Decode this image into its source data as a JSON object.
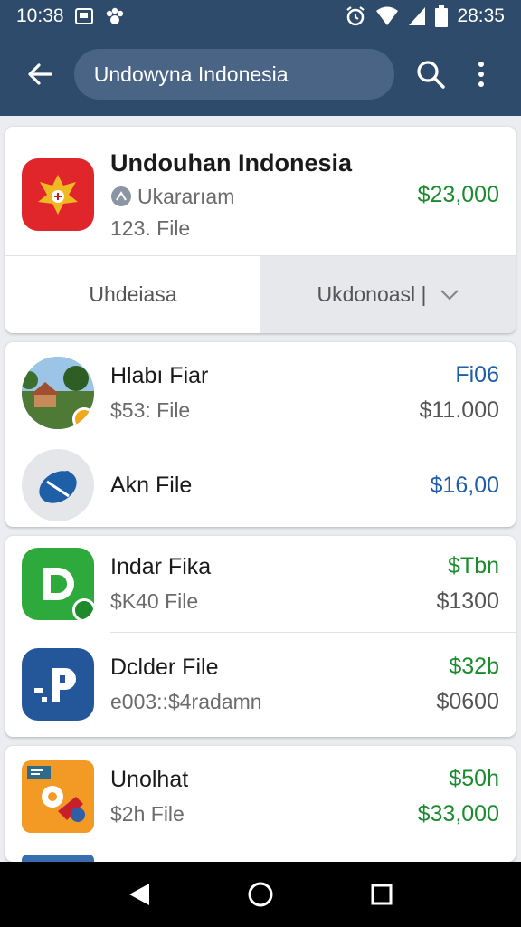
{
  "statusbar": {
    "time_left": "10:38",
    "time_right": "28:35",
    "icons": [
      "gallery-icon",
      "paw-icon",
      "alarm-icon",
      "wifi-icon",
      "signal-icon",
      "battery-icon"
    ]
  },
  "appbar": {
    "search_value": "Undowyna Indonesia",
    "icons": [
      "back-arrow-icon",
      "search-icon",
      "more-vert-icon"
    ]
  },
  "featured": {
    "title": "Undouhan Indonesia",
    "author": "Ukararıam",
    "file_count": "123. File",
    "price": "$23,000",
    "tab_left": "Uhdeiasa",
    "tab_right": "Ukdonoasl |",
    "icon": "garuda-emblem-icon"
  },
  "groups": [
    [
      {
        "title": "Hlabı Fiar",
        "sub": "$53: File",
        "price_top": "Fi06",
        "price_bottom": "$11.000",
        "top_color": "#1f5fa8",
        "icon": "village-photo-icon"
      },
      {
        "title": "Akn File",
        "sub": "",
        "price_top": "",
        "price_bottom": "$16,00",
        "bottom_color": "#1f5fa8",
        "icon": "satellite-dish-icon"
      }
    ],
    [
      {
        "title": "Indar Fika",
        "sub": "$K40 File",
        "price_top": "$Tbn",
        "price_bottom": "$1300",
        "top_color": "#1a8c2e",
        "icon": "green-d-app-icon"
      },
      {
        "title": "Dclder File",
        "sub": "e003::$4radamn",
        "price_top": "$32b",
        "price_bottom": "$0600",
        "top_color": "#1a8c2e",
        "icon": "blue-p-app-icon"
      }
    ],
    [
      {
        "title": "Unolhat",
        "sub": "$2h File",
        "price_top": "$50h",
        "price_bottom": "$33,000",
        "top_color": "#1a8c2e",
        "bottom_color": "#1a8c2e",
        "icon": "gear-tools-icon"
      }
    ]
  ],
  "colors": {
    "appbar": "#2f4b6c",
    "accent_green": "#1a8c2e",
    "accent_blue": "#1f5fa8"
  }
}
